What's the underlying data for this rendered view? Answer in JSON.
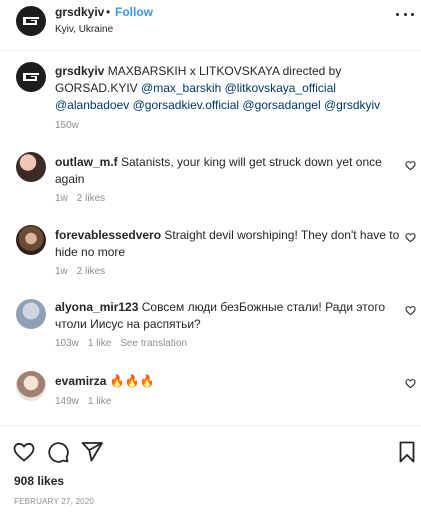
{
  "header": {
    "username": "grsdkyiv",
    "separator": "•",
    "follow_label": "Follow",
    "location": "Kyiv, Ukraine"
  },
  "caption": {
    "username": "grsdkyiv",
    "text_1": " MAXBARSKIH x LITKOVSKAYA directed by GORSAD.KYIV ",
    "mentions": [
      "@max_barskih",
      "@litkovskaya_official",
      "@alanbadoev",
      "@gorsadkiev.official",
      "@gorsadangel",
      "@grsdkyiv"
    ],
    "time": "150w"
  },
  "comments": [
    {
      "username": "outlaw_m.f",
      "text": " Satanists, your king will get struck down yet once again",
      "time": "1w",
      "likes": "2 likes"
    },
    {
      "username": "forevablessedvero",
      "text": " Straight devil worshiping! They don't have to hide no more",
      "time": "1w",
      "likes": "2 likes"
    },
    {
      "username": "alyona_mir123",
      "text": " Совсем люди безБожные стали! Ради этого чтоли Иисус на распятьи?",
      "time": "103w",
      "likes": "1 like",
      "see_translation": "See translation"
    },
    {
      "username": "evamirza",
      "text": " 🔥🔥🔥",
      "time": "149w",
      "likes": "1 like"
    }
  ],
  "footer": {
    "likes": "908 likes",
    "date": "FEBRUARY 27, 2020"
  },
  "icons": {
    "more": "more-options-icon",
    "like": "heart-icon",
    "comment": "comment-icon",
    "share": "share-icon",
    "save": "bookmark-icon"
  },
  "colors": {
    "link_blue": "#3897f0",
    "mention_blue": "#00376b",
    "secondary_text": "#8e8e8e",
    "primary_text": "#262626"
  }
}
